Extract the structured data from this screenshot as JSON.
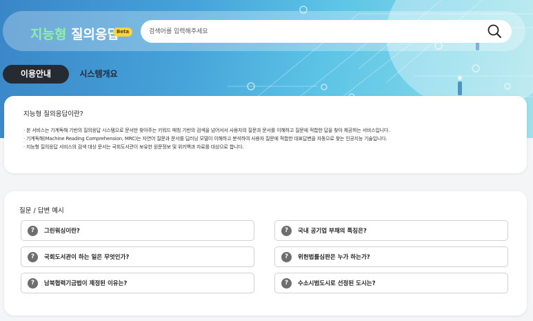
{
  "header": {
    "logo_primary": "지능형",
    "logo_secondary": " 질의응답",
    "beta_badge": "Beta",
    "search": {
      "placeholder": "검색어를 입력해주세요"
    }
  },
  "tabs": [
    {
      "label": "이용안내",
      "active": true
    },
    {
      "label": "시스템개요",
      "active": false
    }
  ],
  "intro": {
    "title": "지능형 질의응답이란?",
    "lines": [
      "· 본 서비스는 기계독해 기반의 질의응답 시스템으로 문서만 찾아주는 키워드 매칭 기반의 검색을 넘어서서 사용자의 질문과 문서를 이해하고 질문에 적합한 답을 찾아 제공하는 서비스입니다.",
      "· 기계독해(Machine Reading Comprehension, MRC)는 자연어 질문과 문서를 딥러닝 모델이 이해하고 분석하여 사용자 질문에 적합한 대표답변을 자동으로 찾는 인공지능 기술입니다.",
      "· 지능형 질의응답 서비스의 검색 대상 문서는 국회도서관이 보유한 원문정보 및 위키백과 자료를 대상으로 합니다."
    ]
  },
  "examples": {
    "title": "질문 / 답변 예시",
    "icon": "question-circle-icon",
    "icon_glyph": "?",
    "left": [
      "그린워싱이란?",
      "국회도서관이 하는 일은 무엇인가?",
      "남북협력기금법이 제정된 이유는?"
    ],
    "right": [
      "국내 공기업 부채의 특징은?",
      "위헌법률심판은 누가 하는가?",
      "수소시범도시로 선정된 도시는?"
    ]
  },
  "colors": {
    "hero_start": "#3a86c8",
    "hero_end": "#9fe1ea",
    "logo_green": "#8ef0a6",
    "beta_badge": "#ffd43a",
    "tab_active": "#262b33"
  }
}
